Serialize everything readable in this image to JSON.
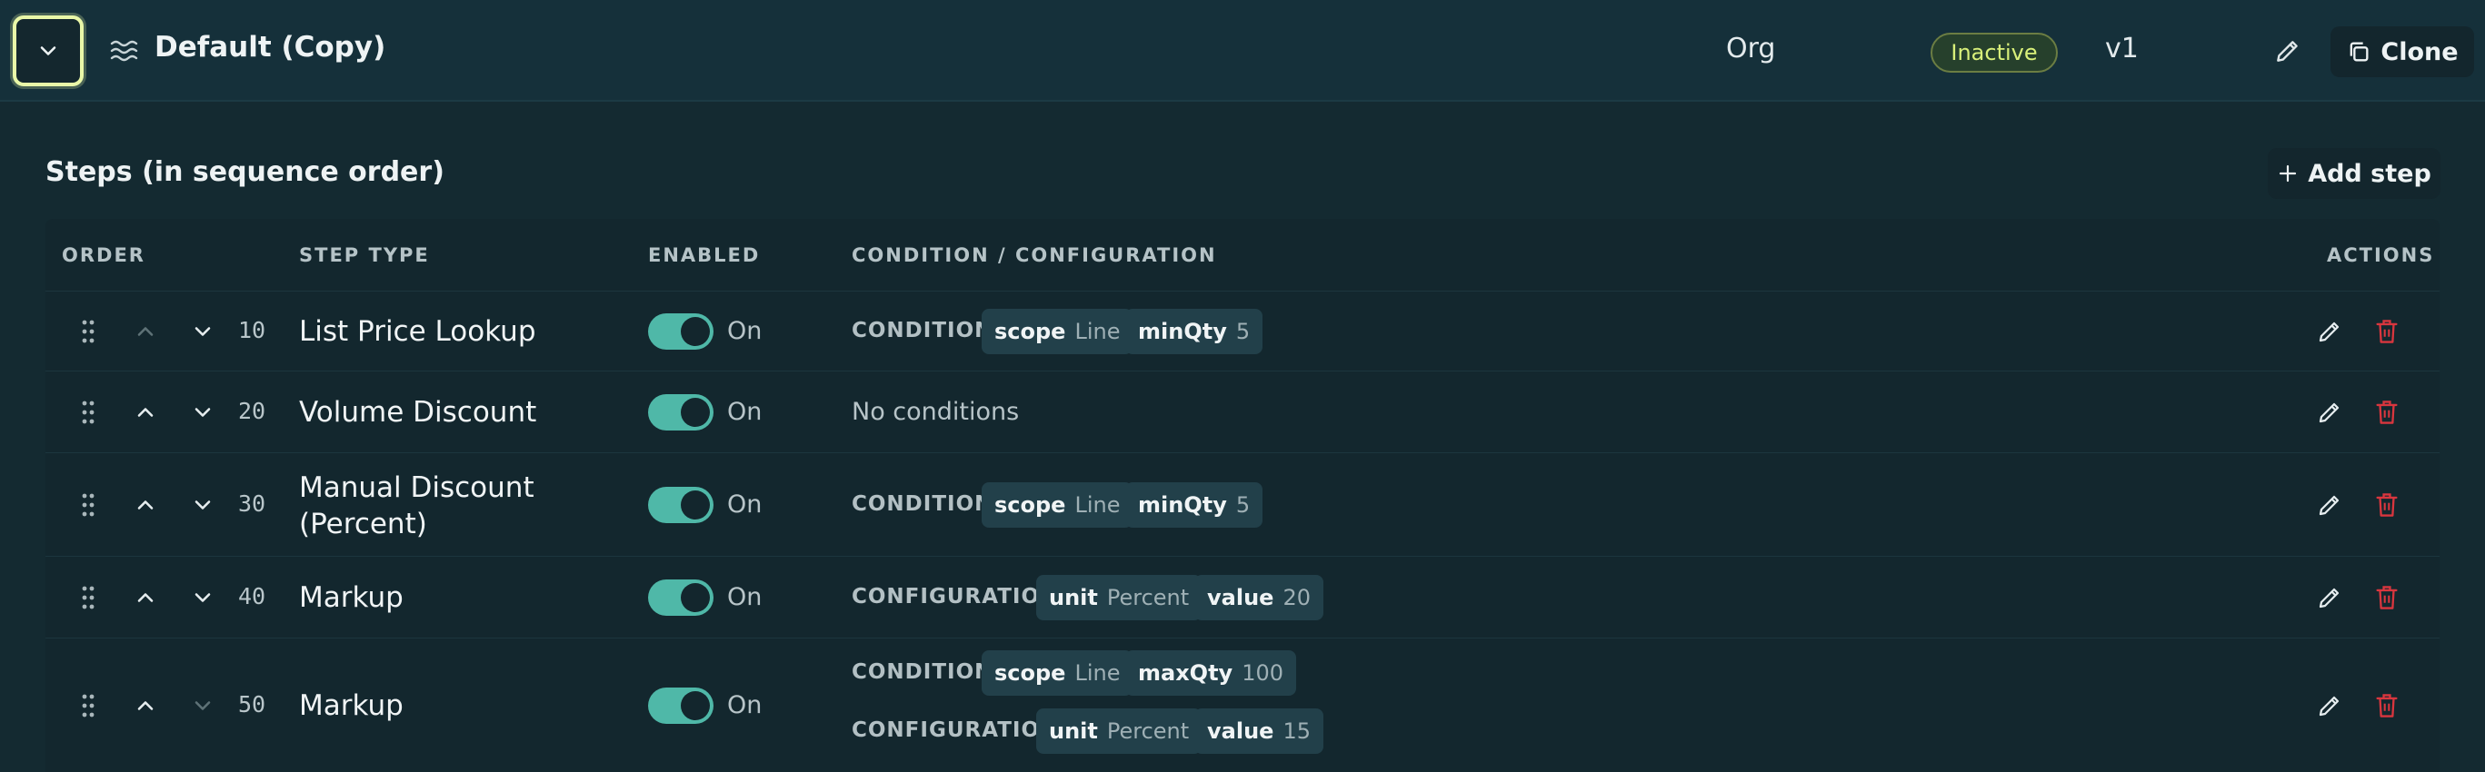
{
  "header": {
    "title": "Default (Copy)",
    "scope": "Org",
    "status": "Inactive",
    "version": "v1",
    "clone_label": "Clone"
  },
  "section": {
    "title": "Steps (in sequence order)",
    "add_step_label": "Add step"
  },
  "table": {
    "columns": {
      "order": "ORDER",
      "step_type": "STEP TYPE",
      "enabled": "ENABLED",
      "condition": "CONDITION / CONFIGURATION",
      "actions": "ACTIONS"
    },
    "rows": [
      {
        "order": "10",
        "step_type": "List Price Lookup",
        "enabled": "On",
        "condition_label": "CONDITION",
        "condition_chips": [
          {
            "key": "scope",
            "value": "Line"
          },
          {
            "key": "minQty",
            "value": "5"
          }
        ]
      },
      {
        "order": "20",
        "step_type": "Volume Discount",
        "enabled": "On",
        "no_conditions": "No conditions"
      },
      {
        "order": "30",
        "step_type_line1": "Manual Discount",
        "step_type_line2": "(Percent)",
        "enabled": "On",
        "condition_label": "CONDITION",
        "condition_chips": [
          {
            "key": "scope",
            "value": "Line"
          },
          {
            "key": "minQty",
            "value": "5"
          }
        ]
      },
      {
        "order": "40",
        "step_type": "Markup",
        "enabled": "On",
        "configuration_label": "CONFIGURATION",
        "configuration_chips": [
          {
            "key": "unit",
            "value": "Percent"
          },
          {
            "key": "value",
            "value": "20"
          }
        ]
      },
      {
        "order": "50",
        "step_type": "Markup",
        "enabled": "On",
        "condition_label": "CONDITION",
        "condition_chips": [
          {
            "key": "scope",
            "value": "Line"
          },
          {
            "key": "maxQty",
            "value": "100"
          }
        ],
        "configuration_label": "CONFIGURATION",
        "configuration_chips": [
          {
            "key": "unit",
            "value": "Percent"
          },
          {
            "key": "value",
            "value": "15"
          }
        ]
      }
    ]
  },
  "colors": {
    "accent": "#4fb8a8",
    "focus_ring": "#e9f7a8",
    "status_inactive": "#d9f07a",
    "danger": "#d9363e"
  }
}
